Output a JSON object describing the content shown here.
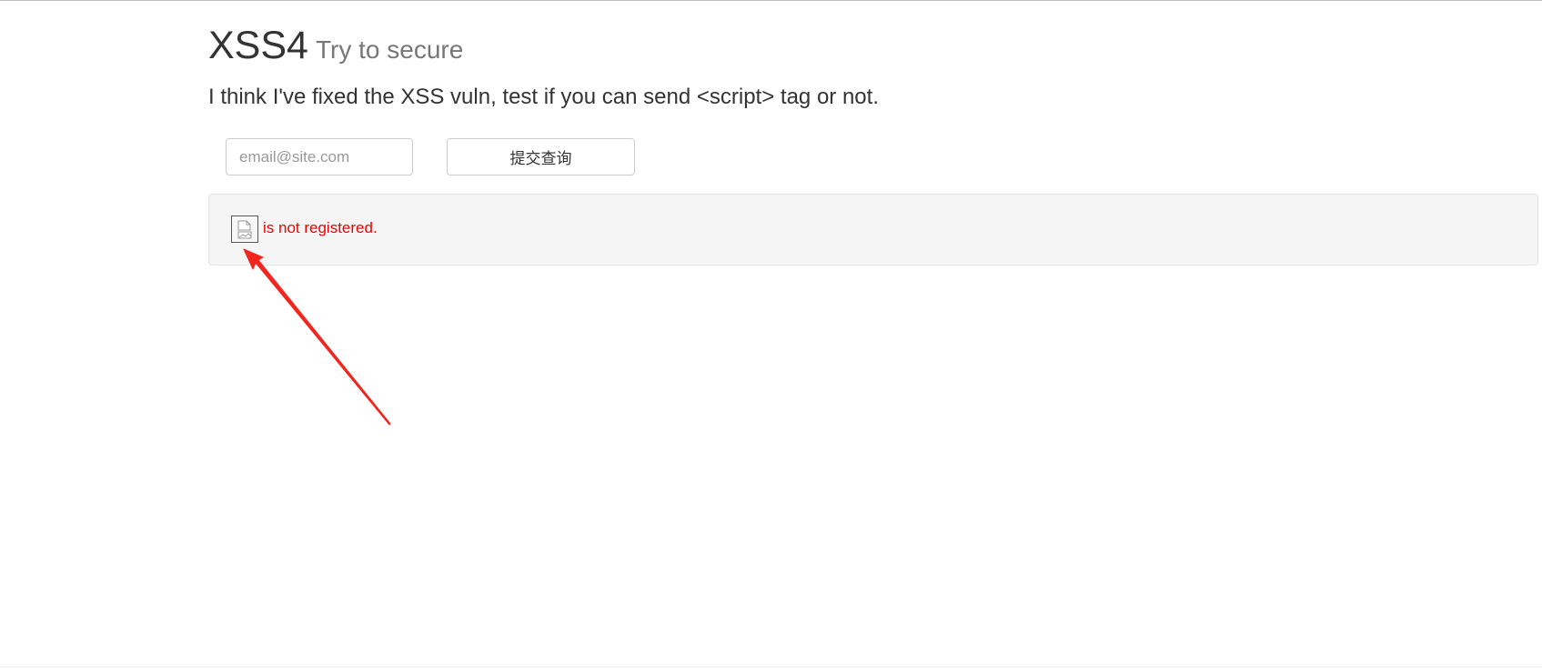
{
  "page": {
    "title": "XSS4",
    "subtitle": "Try to secure",
    "lead": "I think I've fixed the XSS vuln, test if you can send <script> tag or not."
  },
  "form": {
    "email_placeholder": "email@site.com",
    "email_value": "",
    "submit_label": "提交查询"
  },
  "result": {
    "image_icon": "broken-image-icon",
    "message": "is not registered."
  },
  "colors": {
    "result_text": "#ee0000",
    "annotation_arrow": "#f0261f",
    "well_background": "#f5f5f5"
  }
}
